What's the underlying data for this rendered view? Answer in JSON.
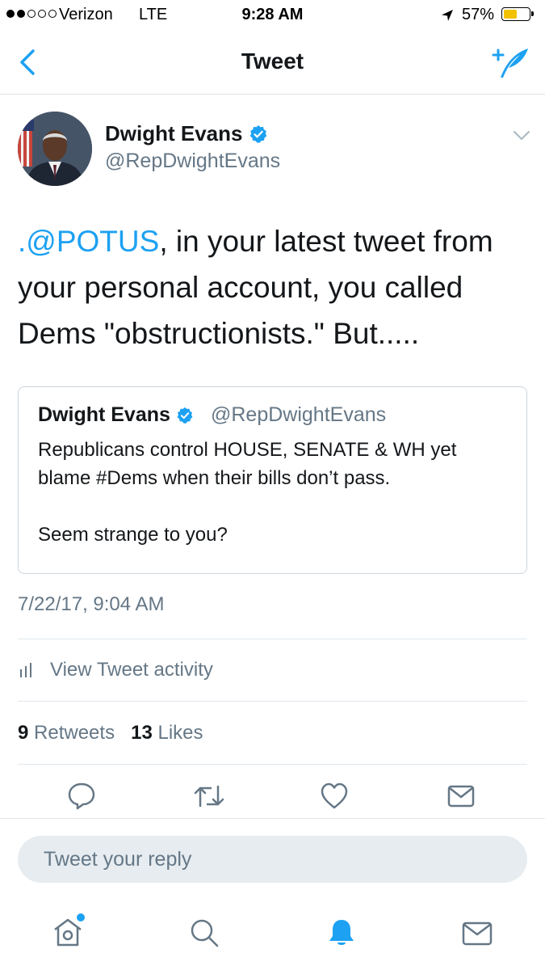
{
  "status_bar": {
    "carrier": "Verizon",
    "network": "LTE",
    "time": "9:28 AM",
    "battery": "57%",
    "battery_level": 0.57,
    "battery_color": "#f2c200"
  },
  "nav": {
    "title": "Tweet",
    "back_icon": "chevron-left-icon",
    "compose_icon": "compose-tweet-icon"
  },
  "tweet": {
    "author": {
      "name": "Dwight Evans",
      "handle": "@RepDwightEvans",
      "verified": true
    },
    "text_mention": ".@POTUS",
    "text_body": ", in your latest tweet from your personal account, you called Dems \"obstructionists.\" But.....",
    "quoted": {
      "name": "Dwight Evans",
      "handle": "@RepDwightEvans",
      "verified": true,
      "text": "Republicans control HOUSE, SENATE & WH yet blame #Dems when their bills don’t pass.\n\nSeem strange to you?"
    },
    "timestamp": "7/22/17, 9:04 AM",
    "activity_label": "View Tweet activity",
    "retweets_count": "9",
    "retweets_label": "Retweets",
    "likes_count": "13",
    "likes_label": "Likes"
  },
  "actions": [
    "reply-icon",
    "retweet-icon",
    "like-icon",
    "direct-message-icon"
  ],
  "reply": {
    "placeholder": "Tweet your reply"
  },
  "tab_bar": [
    "home-icon",
    "search-icon",
    "notifications-icon",
    "messages-icon"
  ],
  "colors": {
    "accent": "#1da1f2",
    "muted": "#657786",
    "text": "#14171a"
  }
}
